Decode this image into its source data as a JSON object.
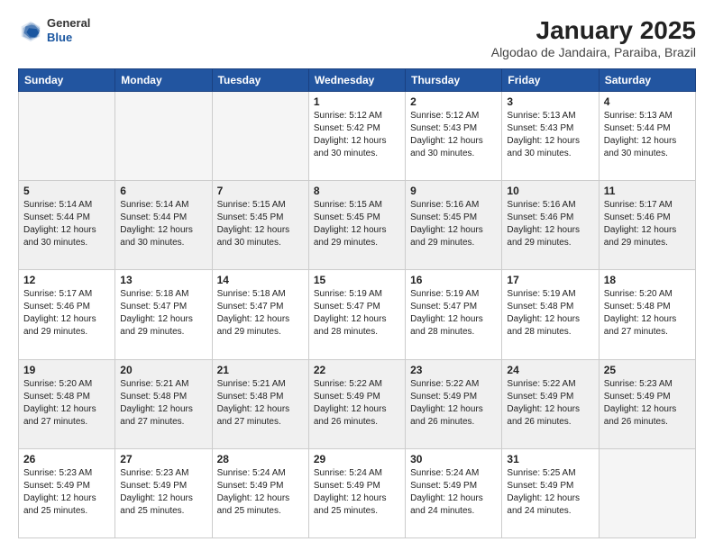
{
  "header": {
    "logo_general": "General",
    "logo_blue": "Blue",
    "title": "January 2025",
    "subtitle": "Algodao de Jandaira, Paraiba, Brazil"
  },
  "weekdays": [
    "Sunday",
    "Monday",
    "Tuesday",
    "Wednesday",
    "Thursday",
    "Friday",
    "Saturday"
  ],
  "weeks": [
    [
      {
        "day": "",
        "info": ""
      },
      {
        "day": "",
        "info": ""
      },
      {
        "day": "",
        "info": ""
      },
      {
        "day": "1",
        "info": "Sunrise: 5:12 AM\nSunset: 5:42 PM\nDaylight: 12 hours\nand 30 minutes."
      },
      {
        "day": "2",
        "info": "Sunrise: 5:12 AM\nSunset: 5:43 PM\nDaylight: 12 hours\nand 30 minutes."
      },
      {
        "day": "3",
        "info": "Sunrise: 5:13 AM\nSunset: 5:43 PM\nDaylight: 12 hours\nand 30 minutes."
      },
      {
        "day": "4",
        "info": "Sunrise: 5:13 AM\nSunset: 5:44 PM\nDaylight: 12 hours\nand 30 minutes."
      }
    ],
    [
      {
        "day": "5",
        "info": "Sunrise: 5:14 AM\nSunset: 5:44 PM\nDaylight: 12 hours\nand 30 minutes."
      },
      {
        "day": "6",
        "info": "Sunrise: 5:14 AM\nSunset: 5:44 PM\nDaylight: 12 hours\nand 30 minutes."
      },
      {
        "day": "7",
        "info": "Sunrise: 5:15 AM\nSunset: 5:45 PM\nDaylight: 12 hours\nand 30 minutes."
      },
      {
        "day": "8",
        "info": "Sunrise: 5:15 AM\nSunset: 5:45 PM\nDaylight: 12 hours\nand 29 minutes."
      },
      {
        "day": "9",
        "info": "Sunrise: 5:16 AM\nSunset: 5:45 PM\nDaylight: 12 hours\nand 29 minutes."
      },
      {
        "day": "10",
        "info": "Sunrise: 5:16 AM\nSunset: 5:46 PM\nDaylight: 12 hours\nand 29 minutes."
      },
      {
        "day": "11",
        "info": "Sunrise: 5:17 AM\nSunset: 5:46 PM\nDaylight: 12 hours\nand 29 minutes."
      }
    ],
    [
      {
        "day": "12",
        "info": "Sunrise: 5:17 AM\nSunset: 5:46 PM\nDaylight: 12 hours\nand 29 minutes."
      },
      {
        "day": "13",
        "info": "Sunrise: 5:18 AM\nSunset: 5:47 PM\nDaylight: 12 hours\nand 29 minutes."
      },
      {
        "day": "14",
        "info": "Sunrise: 5:18 AM\nSunset: 5:47 PM\nDaylight: 12 hours\nand 29 minutes."
      },
      {
        "day": "15",
        "info": "Sunrise: 5:19 AM\nSunset: 5:47 PM\nDaylight: 12 hours\nand 28 minutes."
      },
      {
        "day": "16",
        "info": "Sunrise: 5:19 AM\nSunset: 5:47 PM\nDaylight: 12 hours\nand 28 minutes."
      },
      {
        "day": "17",
        "info": "Sunrise: 5:19 AM\nSunset: 5:48 PM\nDaylight: 12 hours\nand 28 minutes."
      },
      {
        "day": "18",
        "info": "Sunrise: 5:20 AM\nSunset: 5:48 PM\nDaylight: 12 hours\nand 27 minutes."
      }
    ],
    [
      {
        "day": "19",
        "info": "Sunrise: 5:20 AM\nSunset: 5:48 PM\nDaylight: 12 hours\nand 27 minutes."
      },
      {
        "day": "20",
        "info": "Sunrise: 5:21 AM\nSunset: 5:48 PM\nDaylight: 12 hours\nand 27 minutes."
      },
      {
        "day": "21",
        "info": "Sunrise: 5:21 AM\nSunset: 5:48 PM\nDaylight: 12 hours\nand 27 minutes."
      },
      {
        "day": "22",
        "info": "Sunrise: 5:22 AM\nSunset: 5:49 PM\nDaylight: 12 hours\nand 26 minutes."
      },
      {
        "day": "23",
        "info": "Sunrise: 5:22 AM\nSunset: 5:49 PM\nDaylight: 12 hours\nand 26 minutes."
      },
      {
        "day": "24",
        "info": "Sunrise: 5:22 AM\nSunset: 5:49 PM\nDaylight: 12 hours\nand 26 minutes."
      },
      {
        "day": "25",
        "info": "Sunrise: 5:23 AM\nSunset: 5:49 PM\nDaylight: 12 hours\nand 26 minutes."
      }
    ],
    [
      {
        "day": "26",
        "info": "Sunrise: 5:23 AM\nSunset: 5:49 PM\nDaylight: 12 hours\nand 25 minutes."
      },
      {
        "day": "27",
        "info": "Sunrise: 5:23 AM\nSunset: 5:49 PM\nDaylight: 12 hours\nand 25 minutes."
      },
      {
        "day": "28",
        "info": "Sunrise: 5:24 AM\nSunset: 5:49 PM\nDaylight: 12 hours\nand 25 minutes."
      },
      {
        "day": "29",
        "info": "Sunrise: 5:24 AM\nSunset: 5:49 PM\nDaylight: 12 hours\nand 25 minutes."
      },
      {
        "day": "30",
        "info": "Sunrise: 5:24 AM\nSunset: 5:49 PM\nDaylight: 12 hours\nand 24 minutes."
      },
      {
        "day": "31",
        "info": "Sunrise: 5:25 AM\nSunset: 5:49 PM\nDaylight: 12 hours\nand 24 minutes."
      },
      {
        "day": "",
        "info": ""
      }
    ]
  ]
}
